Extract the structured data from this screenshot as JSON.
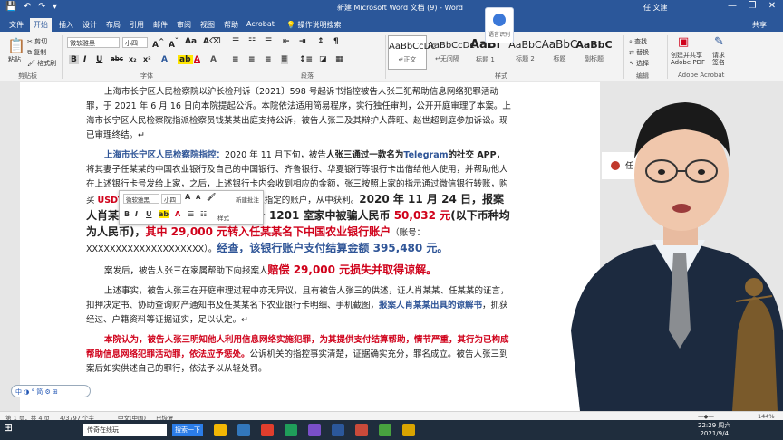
{
  "window": {
    "title": "新建 Microsoft Word 文档 (9) - Word",
    "user": "任 文建",
    "minimize": "—",
    "restore": "❐",
    "close": "✕"
  },
  "tabs": [
    "文件",
    "开始",
    "插入",
    "设计",
    "布局",
    "引用",
    "邮件",
    "审阅",
    "视图",
    "帮助",
    "Acrobat"
  ],
  "tell_me": "操作说明搜索",
  "share": "共享",
  "ribbon": {
    "clipboard": {
      "paste": "粘贴",
      "cut": "剪切",
      "copy": "复制",
      "format_painter": "格式刷",
      "label": "剪贴板"
    },
    "font": {
      "name": "微软雅黑",
      "size": "小四",
      "label": "字体",
      "bold": "B",
      "italic": "I",
      "underline": "U",
      "strike": "abc",
      "sub": "x₂",
      "sup": "x²"
    },
    "paragraph": {
      "label": "段落"
    },
    "styles": {
      "label": "样式",
      "items": [
        {
          "sample": "AaBbCcDc",
          "name": "↵正文"
        },
        {
          "sample": "AaBbCcDc",
          "name": "↵无间隔"
        },
        {
          "sample": "AaBl",
          "name": "标题 1"
        },
        {
          "sample": "AaBbC",
          "name": "标题 2"
        },
        {
          "sample": "AaBbC",
          "name": "标题"
        },
        {
          "sample": "AaBbC",
          "name": "副标题"
        }
      ]
    },
    "editing": {
      "find": "查找",
      "replace": "替换",
      "select": "选择",
      "label": "编辑"
    },
    "acrobat": {
      "create_pdf": "创建并共享 Adobe PDF",
      "request": "请求签名",
      "label": "Adobe Acrobat"
    }
  },
  "voice": {
    "label": "语音识别"
  },
  "document": {
    "p1": "上海市长宁区人民检察院以沪长检刑诉〔2021〕598 号起诉书指控被告人张三犯帮助信息网络犯罪活动罪，于 2021 年 6 月 16 日向本院提起公诉。本院依法适用简易程序，实行独任审判，公开开庭审理了本案。上海市长宁区人民检察院指派检察员钱某某出庭支持公诉，被告人张三及其辩护人薛旺、赵世超到庭参加诉讼。现已审理终结。↵",
    "p2_lead": "上海市长宁区人民检察院指控：",
    "p2_a": "2020 年 11 月下旬，被告",
    "p2_b": "人张三通过一款名为",
    "p2_c": "Telegram",
    "p2_d": "的社交 APP，",
    "p2_e": "将其妻子任某某的中国农业银行及自己的中国银行、齐鲁银行、华夏银行等银行卡出借给他人使用，并帮助他人在上述银行卡号发给上家，之后，上述银行卡内会收到相应的金额，张三按照上家的指示通过微信银行转账，购买 ",
    "p2_f": "USDT 币",
    "p2_g": "，购买之后将信息发给上家并转入指定的账户，从中获利。",
    "p2_h": "2020 年 11 月 24 日，报案人肖某某在本市荣华东道 79 弄 2 号 1201 室家中被骗人民币 ",
    "p2_i": "50,032 元",
    "p2_j": "(以下币种均为人民币)，",
    "p2_k": "其中 29,000 元转入任某某名下中国农业银行账户",
    "p2_l": "（账号：XXXXXXXXXXXXXXXXXXXX）。",
    "p2_m": "经查，该银行账户支付结算金额 395,480 元。",
    "p3_a": "案发后，被告人张三在家属帮助下向报案人",
    "p3_b": "赔偿 29,000 元损失并取得谅解。",
    "p4_a": "上述事实，被告人张三在开庭审理过程中亦无异议，且有被告人张三的供述，证人肖某某、任某某的证言，扣押决定书、协助查询财产通知书及任某某名下农业银行卡明细、手机截图，",
    "p4_b": "报案人肖某某出具的谅解书",
    "p4_c": "，抓获经过、户籍资料等证据证实，足以认定。↵",
    "p5_a": "本院认为，被告人张三明知他人利用信息网络实施犯罪，为其提供支付结算帮助，情节严重，其行为已构成帮助信息网络犯罪活动罪，依法应予惩处。",
    "p5_b": "公诉机关的指控事实清楚，证据确实充分，罪名成立。被告人张三到案后如实供述自己的罪行，依法予以从轻处罚。"
  },
  "minibar": {
    "font": "微软雅黑",
    "size": "小四",
    "grow": "A",
    "shrink": "A",
    "bold": "B",
    "italic": "I",
    "underline": "U",
    "styles": "样式",
    "new_comment": "新建批注"
  },
  "comment": {
    "author": "任"
  },
  "ime": {
    "text": "中 ◑ ° 简 ⚙ ⊞"
  },
  "status": {
    "page": "第 1 页，共 4 页",
    "words": "4/3797 个字",
    "lang": "中文(中国)",
    "accessibility": "已恢复",
    "zoom": "144%"
  },
  "taskbar": {
    "search": "传奇在线玩",
    "active": "搜索一下",
    "time": "22:29 周六",
    "date": "2021/9/4"
  }
}
